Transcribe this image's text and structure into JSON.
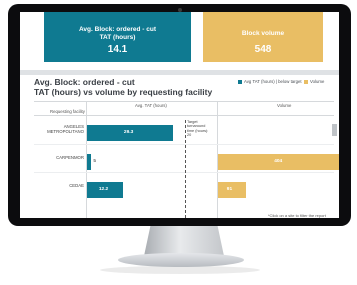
{
  "kpis": {
    "avg_block": {
      "label_line1": "Avg. Block: ordered - cut",
      "label_line2": "TAT (hours)",
      "value": "14.1",
      "color": "#0f7a91"
    },
    "block_volume": {
      "label": "Block volume",
      "value": "548",
      "color": "#e9be64"
    }
  },
  "panel": {
    "title_line1": "Avg. Block: ordered - cut",
    "title_line2": "TAT (hours) vs volume by requesting facility"
  },
  "legend": {
    "items": [
      {
        "label": "Avg TAT (hours) | below target",
        "color": "#0f7a91"
      },
      {
        "label": "Volume",
        "color": "#e9be64"
      }
    ]
  },
  "table": {
    "col_facility": "Requesting facility",
    "col_tat": "Avg. TAT (hours)",
    "col_volume": "Volume",
    "target_note": "Target turnaround time (hours): 20",
    "footnote": "*Click on a site to filter the report"
  },
  "chart_data": {
    "type": "bar",
    "categories": [
      "ANGELES METROPOLITANO",
      "CARPENMOR",
      "CEDAE"
    ],
    "series": [
      {
        "name": "Avg TAT (hours) | below target",
        "values": [
          29.3,
          1.5,
          12.2
        ],
        "labels": [
          "29.3",
          "5",
          "12.2"
        ],
        "color": "#0f7a91"
      },
      {
        "name": "Volume",
        "values": [
          null,
          404,
          91
        ],
        "labels": [
          "",
          "404",
          "91"
        ],
        "color": "#e9be64"
      }
    ],
    "target_tat": 20
  }
}
